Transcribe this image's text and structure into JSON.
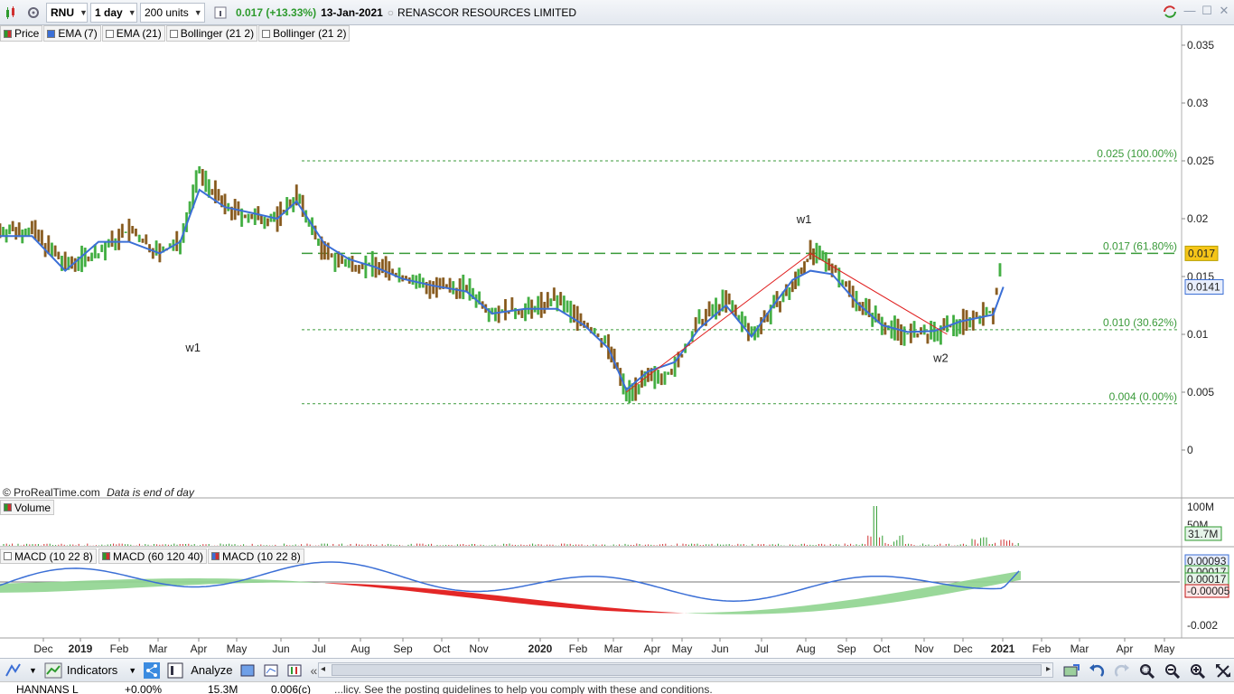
{
  "toolbar": {
    "ticker": "RNU",
    "interval": "1 day",
    "units": "200 units",
    "last_price": "0.017",
    "change": "(+13.33%)",
    "date": "13-Jan-2021",
    "company": "RENASCOR RESOURCES LIMITED"
  },
  "legend": {
    "items": [
      "Price",
      "EMA (7)",
      "EMA (21)",
      "Bollinger (21 2)",
      "Bollinger (21 2)"
    ]
  },
  "price_panel": {
    "y_ticks": [
      "0.035",
      "0.03",
      "0.025",
      "0.02",
      "0.015",
      "0.01",
      "0.005",
      "0"
    ],
    "current_price_badge": "0.017",
    "ema_badge": "0.0141",
    "fib_levels": [
      "0.025 (100.00%)",
      "0.017 (61.80%)",
      "0.010 (30.62%)",
      "0.004 (0.00%)"
    ],
    "wave_labels": [
      "w1",
      "w1",
      "w2"
    ],
    "source_note": "© ProRealTime.com",
    "data_note": "Data is end of day",
    "colors": {
      "ema": "#3b6fd6",
      "fib": "#3a9a3a",
      "trend": "#e02020",
      "badge": "#f5c518"
    }
  },
  "volume_panel": {
    "label": "Volume",
    "y_ticks": [
      "100M",
      "50M"
    ],
    "badge": "31.7M"
  },
  "macd_panel": {
    "labels": [
      "MACD (10 22 8)",
      "MACD (60 120 40)",
      "MACD (10 22 8)"
    ],
    "y_ticks": [
      "0",
      "-0.002"
    ],
    "badges": [
      "0.00093",
      "0.00017",
      "0.00017",
      "-0.00005"
    ]
  },
  "x_axis": {
    "labels": [
      "Dec",
      "2019",
      "Feb",
      "Mar",
      "Apr",
      "May",
      "Jun",
      "Jul",
      "Aug",
      "Sep",
      "Oct",
      "Nov",
      "2020",
      "Feb",
      "Mar",
      "Apr",
      "May",
      "Jun",
      "Jul",
      "Aug",
      "Sep",
      "Oct",
      "Nov",
      "Dec",
      "2021",
      "Feb",
      "Mar",
      "Apr",
      "May"
    ]
  },
  "bottom_bar": {
    "indicators": "Indicators",
    "analyze": "Analyze"
  },
  "status_strip": {
    "symbol": "HANNANS L",
    "change": "+0.00%",
    "volume": "15.3M",
    "price": "0.006(c)",
    "notice": "...licy. See the posting guidelines to help you comply with these and conditions."
  },
  "chart_data": {
    "type": "bar",
    "title": "RENASCOR RESOURCES LIMITED",
    "x_range": [
      "2018-11-20",
      "2021-05-31"
    ],
    "ylim": [
      0,
      0.035
    ],
    "series": [
      {
        "name": "Price",
        "x": [
          "2018-11-20",
          "2018-12-15",
          "2019-01-10",
          "2019-02-05",
          "2019-03-01",
          "2019-03-25",
          "2019-04-10",
          "2019-04-25",
          "2019-05-15",
          "2019-06-05",
          "2019-06-25",
          "2019-07-10",
          "2019-08-01",
          "2019-08-20",
          "2019-09-10",
          "2019-10-01",
          "2019-10-25",
          "2019-11-20",
          "2019-12-10",
          "2020-01-05",
          "2020-01-30",
          "2020-02-20",
          "2020-03-10",
          "2020-03-24",
          "2020-04-10",
          "2020-05-01",
          "2020-05-20",
          "2020-06-10",
          "2020-06-30",
          "2020-07-15",
          "2020-08-01",
          "2020-08-15",
          "2020-09-01",
          "2020-09-20",
          "2020-10-10",
          "2020-10-30",
          "2020-11-20",
          "2020-12-10",
          "2021-01-05",
          "2021-01-13"
        ],
        "values": [
          0.019,
          0.019,
          0.016,
          0.017,
          0.019,
          0.017,
          0.018,
          0.024,
          0.021,
          0.02,
          0.02,
          0.022,
          0.017,
          0.016,
          0.016,
          0.015,
          0.014,
          0.014,
          0.012,
          0.012,
          0.013,
          0.011,
          0.009,
          0.005,
          0.006,
          0.007,
          0.011,
          0.013,
          0.01,
          0.012,
          0.014,
          0.017,
          0.016,
          0.013,
          0.011,
          0.01,
          0.01,
          0.011,
          0.012,
          0.017
        ]
      },
      {
        "name": "EMA (7)",
        "x": [
          "2018-11-20",
          "2018-12-15",
          "2019-01-10",
          "2019-02-05",
          "2019-03-01",
          "2019-03-25",
          "2019-04-10",
          "2019-04-25",
          "2019-05-15",
          "2019-06-05",
          "2019-06-25",
          "2019-07-10",
          "2019-08-01",
          "2019-08-20",
          "2019-09-10",
          "2019-10-01",
          "2019-10-25",
          "2019-11-20",
          "2019-12-10",
          "2020-01-05",
          "2020-01-30",
          "2020-02-20",
          "2020-03-10",
          "2020-03-24",
          "2020-04-10",
          "2020-05-01",
          "2020-05-20",
          "2020-06-10",
          "2020-06-30",
          "2020-07-15",
          "2020-08-01",
          "2020-08-15",
          "2020-09-01",
          "2020-09-20",
          "2020-10-10",
          "2020-10-30",
          "2020-11-20",
          "2020-12-10",
          "2021-01-05",
          "2021-01-13"
        ],
        "values": [
          0.0185,
          0.0185,
          0.0155,
          0.018,
          0.018,
          0.017,
          0.018,
          0.0225,
          0.021,
          0.0205,
          0.02,
          0.0215,
          0.0178,
          0.0165,
          0.0158,
          0.0148,
          0.0142,
          0.0137,
          0.0118,
          0.0122,
          0.0122,
          0.0108,
          0.0088,
          0.0052,
          0.0068,
          0.0076,
          0.0105,
          0.0125,
          0.0098,
          0.0122,
          0.0147,
          0.0155,
          0.0152,
          0.0128,
          0.0108,
          0.0102,
          0.0103,
          0.0111,
          0.0117,
          0.0141
        ]
      }
    ],
    "fib_levels": [
      0.025,
      0.017,
      0.0104,
      0.004
    ],
    "volume_ylim": [
      0,
      100000000
    ],
    "macd_ylim": [
      -0.0025,
      0.0015
    ]
  }
}
